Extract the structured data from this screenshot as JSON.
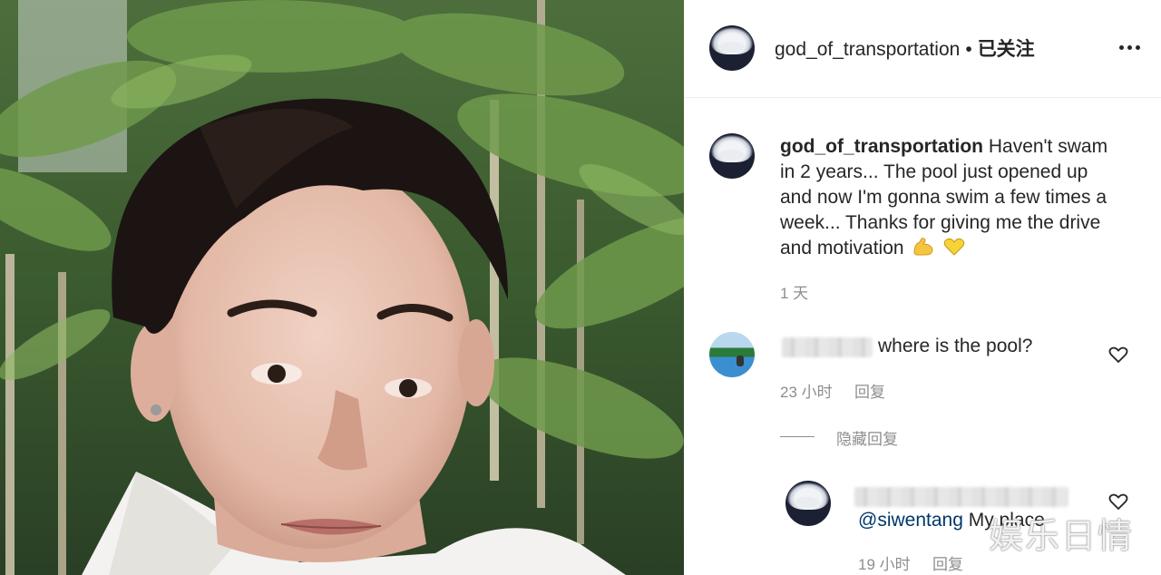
{
  "post": {
    "username": "god_of_transportation",
    "dot": "•",
    "follow_status": "已关注",
    "more_icon": "more-horizontal-icon"
  },
  "caption": {
    "username": "god_of_transportation",
    "text": "Haven't swam in 2 years... The pool just opened up and now I'm gonna swim a few times a week... Thanks for giving me the drive and motivation",
    "emojis": [
      "muscle-emoji",
      "yellow-heart-emoji"
    ],
    "time": "1 天"
  },
  "comments": [
    {
      "text": "where is the pool?",
      "time": "23 小时",
      "reply_label": "回复",
      "heart_icon": "heart-icon"
    }
  ],
  "hide_replies_label": "隐藏回复",
  "reply": {
    "mention": "@siwentang",
    "text": "My place",
    "time": "19 小时",
    "reply_label": "回复",
    "heart_icon": "heart-icon"
  },
  "watermark": "娱乐日情"
}
